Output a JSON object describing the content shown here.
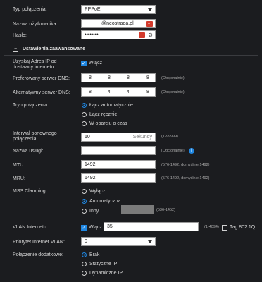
{
  "connection_type": {
    "label": "Typ połączenia:",
    "value": "PPPoE"
  },
  "username": {
    "label": "Nazwa użytkownika:",
    "value": "@neostrada.pl"
  },
  "password": {
    "label": "Hasło:",
    "value": "••••••••"
  },
  "advanced": {
    "toggle": "−",
    "label": "Ustawienia zaawansowane"
  },
  "dns_auto": {
    "label": "Uzyskaj Adres IP od dostawcy internetu:",
    "checkbox_label": "Włącz"
  },
  "dns_primary": {
    "label": "Preferowany serwer DNS:",
    "octets": [
      "8",
      "8",
      "8",
      "8"
    ],
    "note": "(Opcjonalnie)"
  },
  "dns_secondary": {
    "label": "Alternatywny serwer DNS:",
    "octets": [
      "8",
      "4",
      "4",
      "8"
    ],
    "note": "(Opcjonalnie)"
  },
  "conn_mode": {
    "label": "Tryb połączenia:",
    "options": [
      "Łącz automatycznie",
      "Łącz ręcznie",
      "W oparciu o czas"
    ],
    "selected": 0
  },
  "reconnect": {
    "label": "Interwał ponownego połączenia:",
    "value": "10",
    "unit": "Sekundy",
    "note": "(1-99999)"
  },
  "service": {
    "label": "Nazwa usługi:",
    "value": "",
    "note": "(Opcjonalnie)"
  },
  "mtu": {
    "label": "MTU:",
    "value": "1492",
    "note": "(576-1492, domyślnie:1492)"
  },
  "mru": {
    "label": "MRU:",
    "value": "1492",
    "note": "(576-1492, domyślnie:1492)"
  },
  "mss": {
    "label": "MSS Clamping:",
    "options": [
      "Wyłącz",
      "Automatyczna",
      "Inny"
    ],
    "selected": 1,
    "note": "(536-1452)"
  },
  "vlan": {
    "label": "VLAN Internetu:",
    "checkbox_label": "Włącz",
    "value": "35",
    "note": "(1-4094)",
    "tag_label": "Tag 802.1Q"
  },
  "vlan_priority": {
    "label": "Priorytet Internet VLAN:",
    "value": "0"
  },
  "extra": {
    "label": "Połączenie dodatkowe:",
    "options": [
      "Brak",
      "Statyczne IP",
      "Dynamiczne IP"
    ],
    "selected": 0
  },
  "colors": {
    "accent": "#1f86e0",
    "red": "#d33a2c",
    "bg": "#1b1c1f"
  }
}
